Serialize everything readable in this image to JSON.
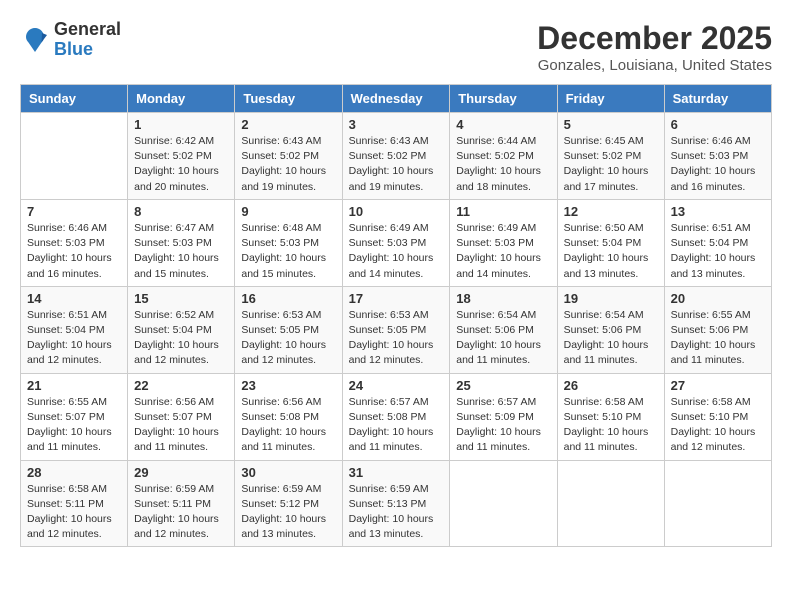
{
  "header": {
    "logo_general": "General",
    "logo_blue": "Blue",
    "month": "December 2025",
    "location": "Gonzales, Louisiana, United States"
  },
  "days_of_week": [
    "Sunday",
    "Monday",
    "Tuesday",
    "Wednesday",
    "Thursday",
    "Friday",
    "Saturday"
  ],
  "weeks": [
    [
      {
        "day": "",
        "info": ""
      },
      {
        "day": "1",
        "info": "Sunrise: 6:42 AM\nSunset: 5:02 PM\nDaylight: 10 hours\nand 20 minutes."
      },
      {
        "day": "2",
        "info": "Sunrise: 6:43 AM\nSunset: 5:02 PM\nDaylight: 10 hours\nand 19 minutes."
      },
      {
        "day": "3",
        "info": "Sunrise: 6:43 AM\nSunset: 5:02 PM\nDaylight: 10 hours\nand 19 minutes."
      },
      {
        "day": "4",
        "info": "Sunrise: 6:44 AM\nSunset: 5:02 PM\nDaylight: 10 hours\nand 18 minutes."
      },
      {
        "day": "5",
        "info": "Sunrise: 6:45 AM\nSunset: 5:02 PM\nDaylight: 10 hours\nand 17 minutes."
      },
      {
        "day": "6",
        "info": "Sunrise: 6:46 AM\nSunset: 5:03 PM\nDaylight: 10 hours\nand 16 minutes."
      }
    ],
    [
      {
        "day": "7",
        "info": "Sunrise: 6:46 AM\nSunset: 5:03 PM\nDaylight: 10 hours\nand 16 minutes."
      },
      {
        "day": "8",
        "info": "Sunrise: 6:47 AM\nSunset: 5:03 PM\nDaylight: 10 hours\nand 15 minutes."
      },
      {
        "day": "9",
        "info": "Sunrise: 6:48 AM\nSunset: 5:03 PM\nDaylight: 10 hours\nand 15 minutes."
      },
      {
        "day": "10",
        "info": "Sunrise: 6:49 AM\nSunset: 5:03 PM\nDaylight: 10 hours\nand 14 minutes."
      },
      {
        "day": "11",
        "info": "Sunrise: 6:49 AM\nSunset: 5:03 PM\nDaylight: 10 hours\nand 14 minutes."
      },
      {
        "day": "12",
        "info": "Sunrise: 6:50 AM\nSunset: 5:04 PM\nDaylight: 10 hours\nand 13 minutes."
      },
      {
        "day": "13",
        "info": "Sunrise: 6:51 AM\nSunset: 5:04 PM\nDaylight: 10 hours\nand 13 minutes."
      }
    ],
    [
      {
        "day": "14",
        "info": "Sunrise: 6:51 AM\nSunset: 5:04 PM\nDaylight: 10 hours\nand 12 minutes."
      },
      {
        "day": "15",
        "info": "Sunrise: 6:52 AM\nSunset: 5:04 PM\nDaylight: 10 hours\nand 12 minutes."
      },
      {
        "day": "16",
        "info": "Sunrise: 6:53 AM\nSunset: 5:05 PM\nDaylight: 10 hours\nand 12 minutes."
      },
      {
        "day": "17",
        "info": "Sunrise: 6:53 AM\nSunset: 5:05 PM\nDaylight: 10 hours\nand 12 minutes."
      },
      {
        "day": "18",
        "info": "Sunrise: 6:54 AM\nSunset: 5:06 PM\nDaylight: 10 hours\nand 11 minutes."
      },
      {
        "day": "19",
        "info": "Sunrise: 6:54 AM\nSunset: 5:06 PM\nDaylight: 10 hours\nand 11 minutes."
      },
      {
        "day": "20",
        "info": "Sunrise: 6:55 AM\nSunset: 5:06 PM\nDaylight: 10 hours\nand 11 minutes."
      }
    ],
    [
      {
        "day": "21",
        "info": "Sunrise: 6:55 AM\nSunset: 5:07 PM\nDaylight: 10 hours\nand 11 minutes."
      },
      {
        "day": "22",
        "info": "Sunrise: 6:56 AM\nSunset: 5:07 PM\nDaylight: 10 hours\nand 11 minutes."
      },
      {
        "day": "23",
        "info": "Sunrise: 6:56 AM\nSunset: 5:08 PM\nDaylight: 10 hours\nand 11 minutes."
      },
      {
        "day": "24",
        "info": "Sunrise: 6:57 AM\nSunset: 5:08 PM\nDaylight: 10 hours\nand 11 minutes."
      },
      {
        "day": "25",
        "info": "Sunrise: 6:57 AM\nSunset: 5:09 PM\nDaylight: 10 hours\nand 11 minutes."
      },
      {
        "day": "26",
        "info": "Sunrise: 6:58 AM\nSunset: 5:10 PM\nDaylight: 10 hours\nand 11 minutes."
      },
      {
        "day": "27",
        "info": "Sunrise: 6:58 AM\nSunset: 5:10 PM\nDaylight: 10 hours\nand 12 minutes."
      }
    ],
    [
      {
        "day": "28",
        "info": "Sunrise: 6:58 AM\nSunset: 5:11 PM\nDaylight: 10 hours\nand 12 minutes."
      },
      {
        "day": "29",
        "info": "Sunrise: 6:59 AM\nSunset: 5:11 PM\nDaylight: 10 hours\nand 12 minutes."
      },
      {
        "day": "30",
        "info": "Sunrise: 6:59 AM\nSunset: 5:12 PM\nDaylight: 10 hours\nand 13 minutes."
      },
      {
        "day": "31",
        "info": "Sunrise: 6:59 AM\nSunset: 5:13 PM\nDaylight: 10 hours\nand 13 minutes."
      },
      {
        "day": "",
        "info": ""
      },
      {
        "day": "",
        "info": ""
      },
      {
        "day": "",
        "info": ""
      }
    ]
  ]
}
